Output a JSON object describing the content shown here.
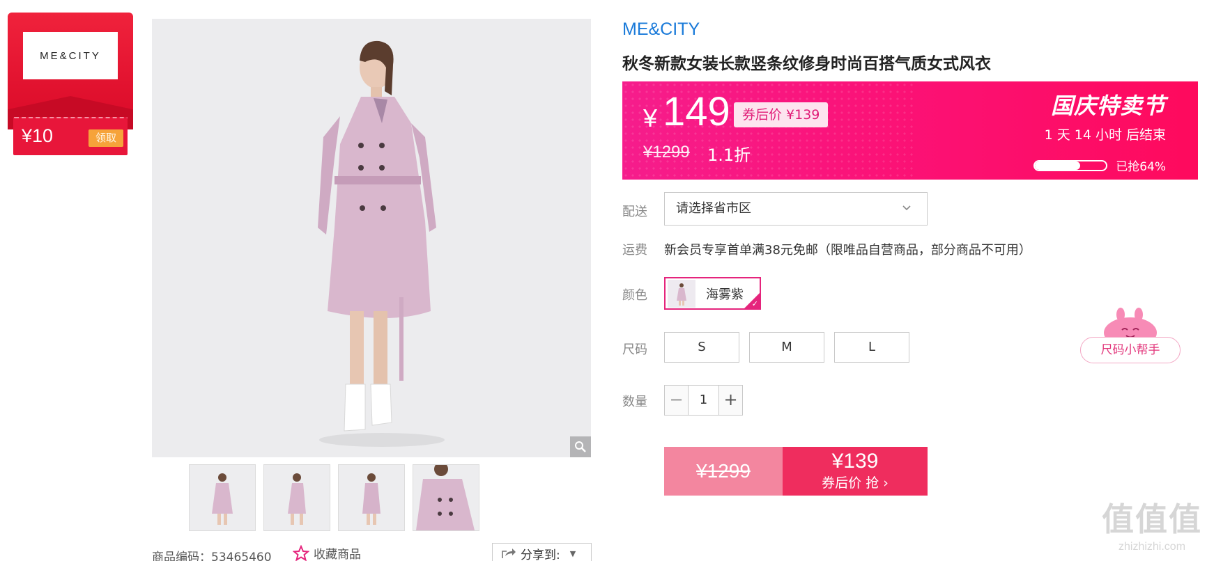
{
  "coupon": {
    "logo_text": "ME&CITY",
    "amount": "¥10",
    "claim_label": "领取",
    "colors": {
      "red": "#e8163a",
      "claim": "#f6a33a"
    }
  },
  "gallery": {
    "thumbnail_count": 4,
    "sku_code": "商品编码：53465460",
    "favorite_label": "收藏商品",
    "share_label": "分享到:"
  },
  "product": {
    "brand": "ME&CITY",
    "title": "秋冬新款女装长款竖条纹修身时尚百搭气质女式风衣"
  },
  "price": {
    "currency": "¥",
    "current": "149",
    "coupon_price": "券后价 ¥139",
    "original": "¥1299",
    "discount": "1.1折",
    "campaign": "国庆特卖节",
    "countdown": "1  天  14  小时  后结束",
    "sold_percent": 64,
    "sold_text": "已抢64%",
    "colors": {
      "banner_start": "#f61d8c",
      "banner_end": "#fe0a5d"
    }
  },
  "delivery": {
    "label": "配送",
    "placeholder": "请选择省市区"
  },
  "shipping": {
    "label": "运费",
    "text": "新会员专享首单满38元免邮（限唯品自营商品，部分商品不可用）"
  },
  "color": {
    "label": "颜色",
    "option": "海雾紫",
    "selected": true
  },
  "size": {
    "label": "尺码",
    "options": [
      "S",
      "M",
      "L"
    ]
  },
  "quantity": {
    "label": "数量",
    "minus": "−",
    "value": "1",
    "plus": "+"
  },
  "buy": {
    "original": "¥1299",
    "price": "¥139",
    "subtitle": "券后价 抢 ›",
    "colors": {
      "left": "#f3869f",
      "right": "#ef2d5e"
    }
  },
  "size_helper": {
    "label": "尺码小帮手"
  },
  "watermark": {
    "main": "值值值",
    "url": "zhizhizhi.com"
  }
}
